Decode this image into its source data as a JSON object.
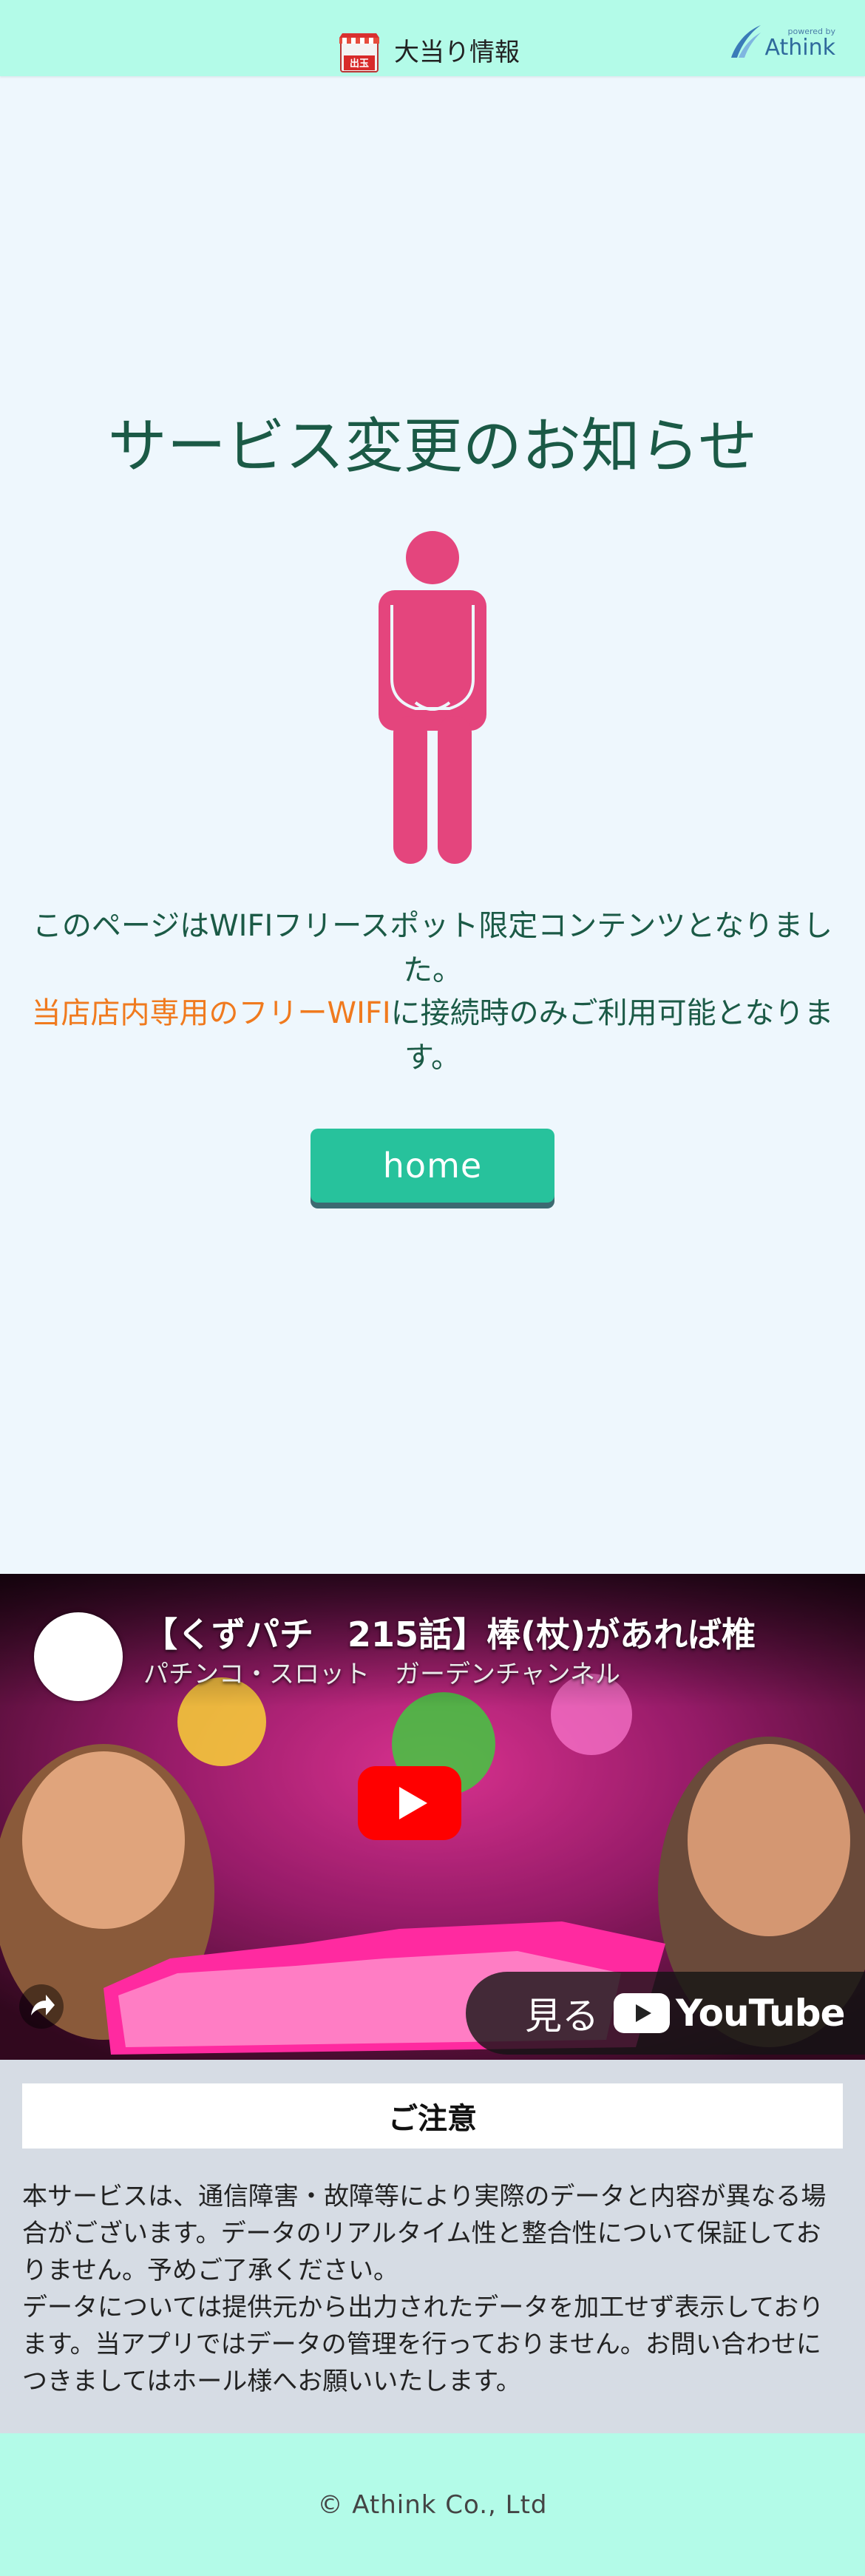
{
  "header": {
    "shop_icon_label": "出玉",
    "title": "大当り情報",
    "brand_powered": "powered by",
    "brand_name": "Athink"
  },
  "notice": {
    "title": "サービス変更のお知らせ",
    "figure_icon": "bowing-person-icon",
    "figure_color": "#e4457d",
    "message_line1": "このページはWIFIフリースポット限定コンテンツとなりました。",
    "message_line2_highlight": "当店店内専用のフリーWIFI",
    "message_line2_rest": "に接続時のみご利用可能となります。",
    "highlight_color": "#f07a1e"
  },
  "home_button": {
    "label": "home",
    "color": "#27c29c"
  },
  "video": {
    "title": "【くずパチ　215話】棒(杖)があれば椎",
    "channel": "パチンコ・スロット　ガーデンチャンネル",
    "watch_label": "見る",
    "platform": "YouTube"
  },
  "caution": {
    "heading": "ご注意",
    "paragraphs": [
      "本サービスは、通信障害・故障等により実際のデータと内容が異なる場合がございます。データのリアルタイム性と整合性について保証しておりません。予めご了承ください。",
      "データについては提供元から出力されたデータを加工せず表示しております。当アプリではデータの管理を行っておりません。お問い合わせにつきましてはホール様へお願いいたします。"
    ]
  },
  "footer": {
    "copyright": "© Athink Co., Ltd"
  },
  "colors": {
    "header_bg": "#b3fbe8",
    "page_bg": "#eef7fd",
    "title_color": "#1b5a46",
    "caution_bg": "#d6dce4"
  }
}
